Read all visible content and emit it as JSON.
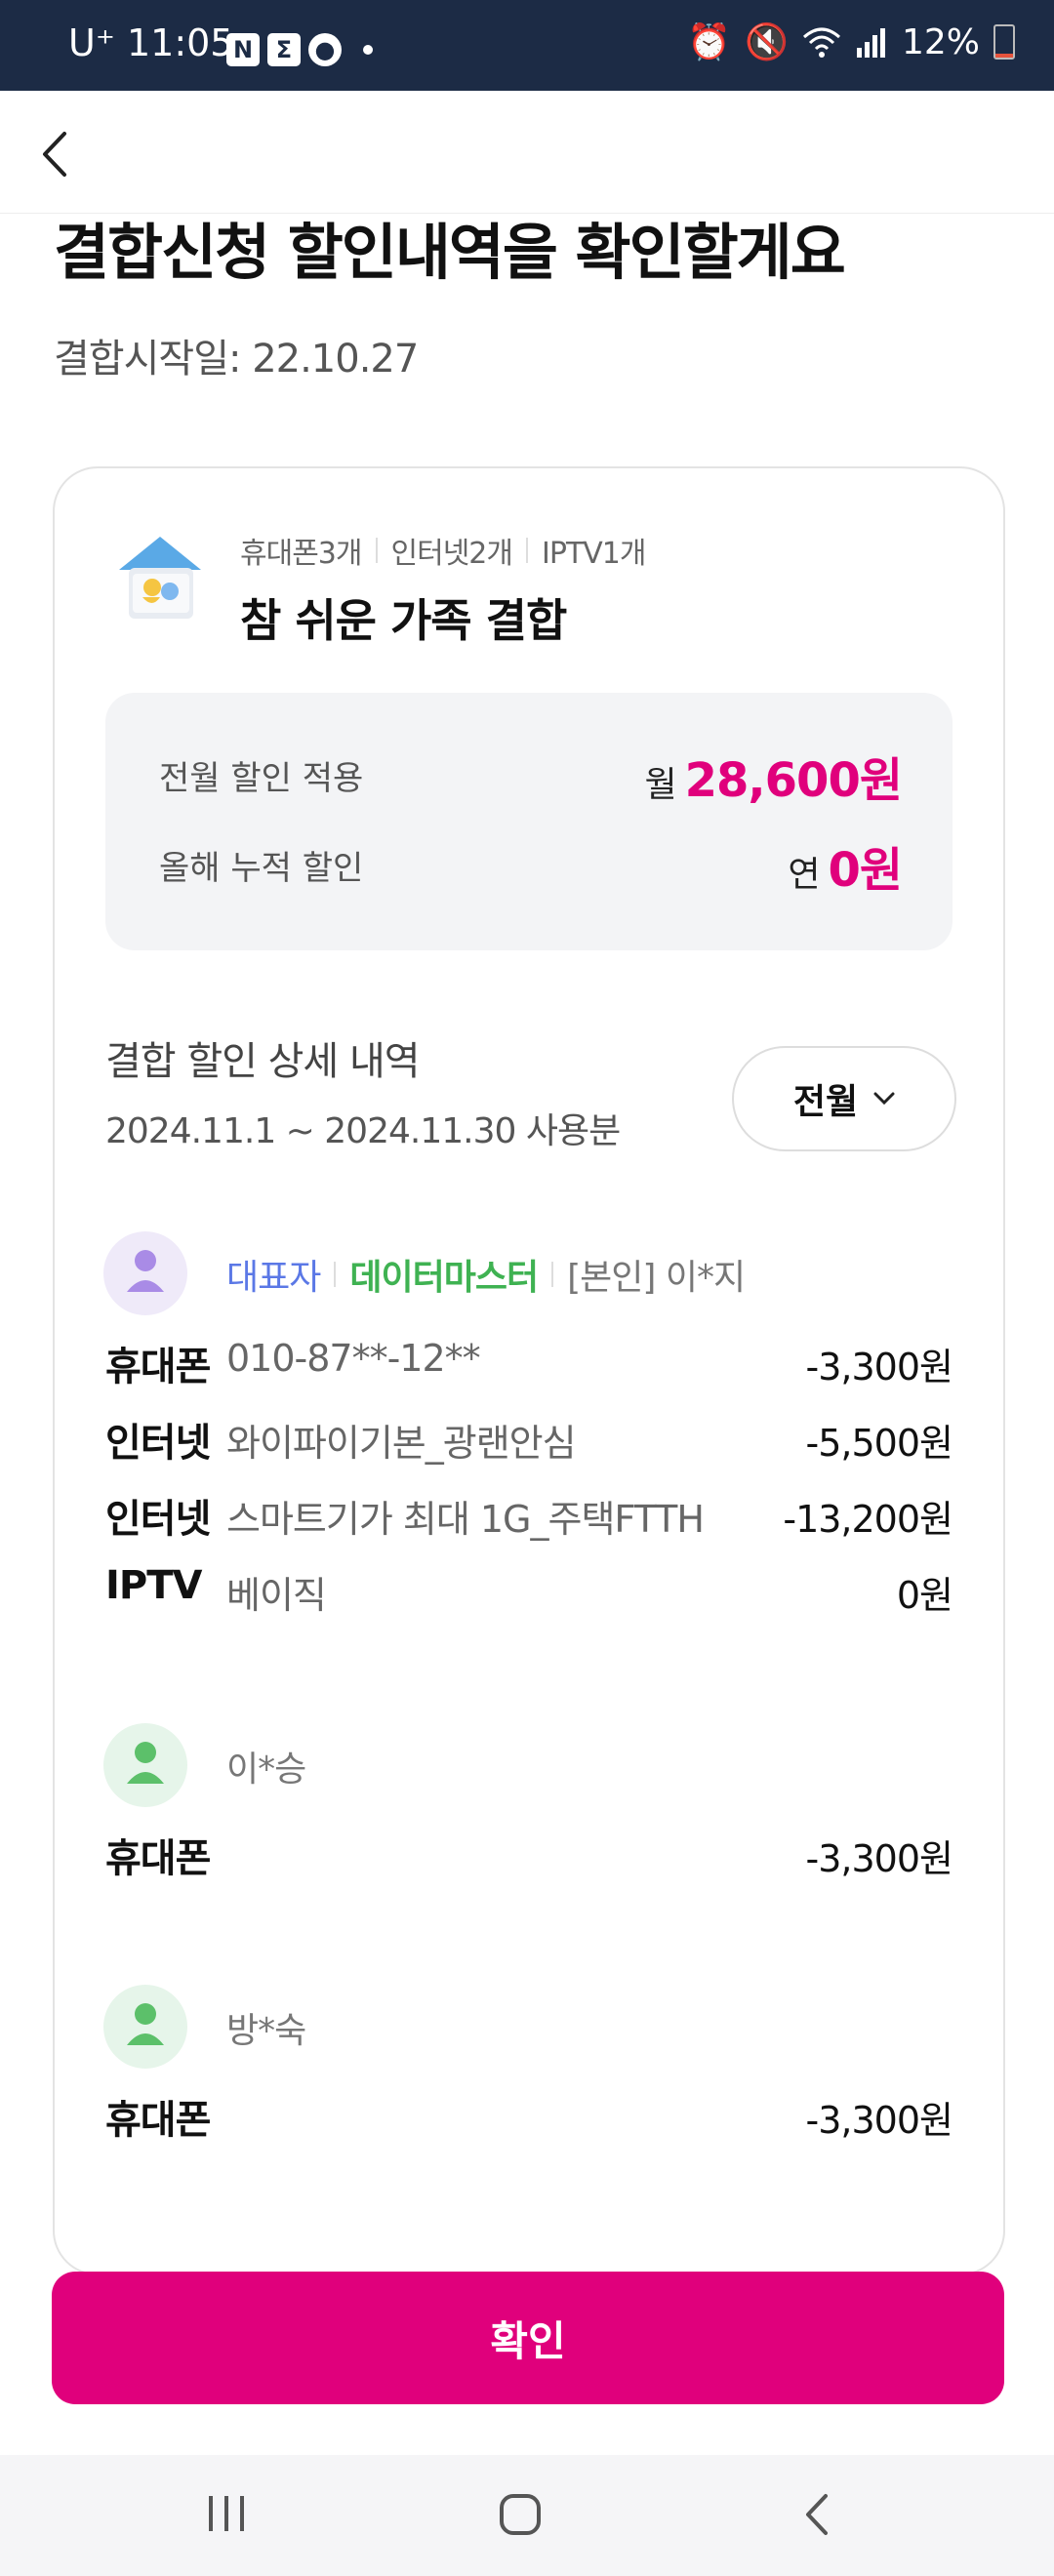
{
  "status_bar": {
    "carrier": "U⁺",
    "time": "11:05",
    "battery": "12%",
    "battery_level": 0.12
  },
  "page": {
    "title": "결합신청 할인내역을 확인할게요",
    "start_date": "결합시작일: 22.10.27"
  },
  "bundle": {
    "counts": [
      "휴대폰3개",
      "인터넷2개",
      "IPTV1개"
    ],
    "plan_name": "참 쉬운 가족 결합",
    "summary": [
      {
        "label": "전월 할인 적용",
        "unit": "월",
        "amount": "28,600원"
      },
      {
        "label": "올해 누적 할인",
        "unit": "연",
        "amount": "0원"
      }
    ]
  },
  "details": {
    "title": "결합 할인 상세 내역",
    "period": "2024.11.1 ~ 2024.11.30 사용분",
    "month_select": "전월"
  },
  "members": [
    {
      "role": "대표자",
      "plan": "데이터마스터",
      "name": "[본인] 이*지",
      "items": [
        {
          "kind": "휴대폰",
          "desc": "010-87**-12**",
          "amount": "-3,300원"
        },
        {
          "kind": "인터넷",
          "desc": "와이파이기본_광랜안심",
          "amount": "-5,500원"
        },
        {
          "kind": "인터넷",
          "desc": "스마트기가 최대 1G_주택FTTH",
          "amount": "-13,200원"
        },
        {
          "kind": "IPTV",
          "desc": "베이직",
          "amount": "0원"
        }
      ]
    },
    {
      "name": "이*승",
      "items": [
        {
          "kind": "휴대폰",
          "desc": "",
          "amount": "-3,300원"
        }
      ]
    },
    {
      "name": "방*숙",
      "items": [
        {
          "kind": "휴대폰",
          "desc": "",
          "amount": "-3,300원"
        }
      ]
    }
  ],
  "confirm_label": "확인",
  "colors": {
    "accent": "#e0007c",
    "status_bar": "#1c2b45",
    "representative": "#5b78e6",
    "plan_tag": "#3fb252"
  },
  "icons": [
    "back-arrow-icon",
    "house-icon",
    "chevron-down-icon",
    "person-icon",
    "recent-apps-icon",
    "home-icon",
    "nav-back-icon"
  ]
}
